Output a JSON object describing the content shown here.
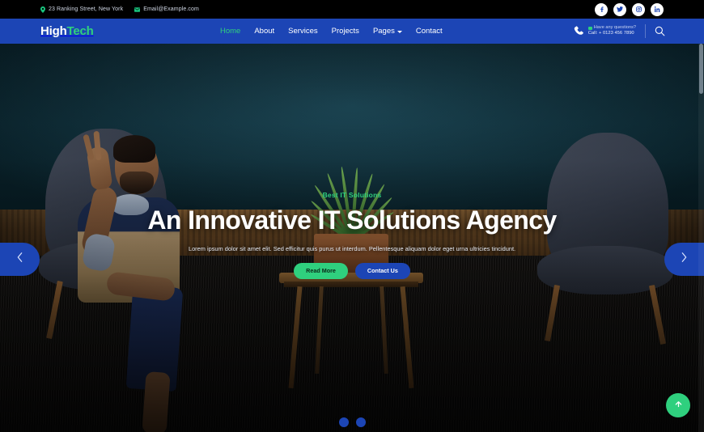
{
  "topbar": {
    "address": "23 Ranking Street, New York",
    "address_icon": "location-pin-icon",
    "email": "Email@Example.com",
    "email_icon": "envelope-icon",
    "social": [
      {
        "name": "facebook",
        "label": "f"
      },
      {
        "name": "twitter",
        "label": "t"
      },
      {
        "name": "instagram",
        "label": "ig"
      },
      {
        "name": "linkedin",
        "label": "in"
      }
    ]
  },
  "nav": {
    "logo_first": "High",
    "logo_second": "Tech",
    "menu": [
      {
        "label": "Home",
        "active": true
      },
      {
        "label": "About",
        "active": false
      },
      {
        "label": "Services",
        "active": false
      },
      {
        "label": "Projects",
        "active": false
      },
      {
        "label": "Pages",
        "active": false,
        "has_dropdown": true
      },
      {
        "label": "Contact",
        "active": false
      }
    ],
    "phone_icon": "phone-icon",
    "phone_question": "Have any questions?",
    "phone_number": "Call: + 0123 456 7890",
    "search_icon": "search-icon"
  },
  "hero": {
    "eyebrow": "Best IT Solutions",
    "headline": "An Innovative IT Solutions Agency",
    "paragraph": "Lorem ipsum dolor sit amet elit. Sed efficitur quis purus ut interdum. Pellentesque aliquam dolor eget urna ultricies tincidunt.",
    "primary_button": "Read More",
    "secondary_button": "Contact Us",
    "prev_icon": "chevron-left-icon",
    "next_icon": "chevron-right-icon",
    "slides": 2,
    "active_slide": 1
  },
  "fab": {
    "icon": "arrow-up-icon"
  },
  "colors": {
    "nav_blue": "#1c45b5",
    "accent_green": "#2fd07e",
    "topbar_black": "#000000",
    "wall_teal": "#14495a"
  }
}
